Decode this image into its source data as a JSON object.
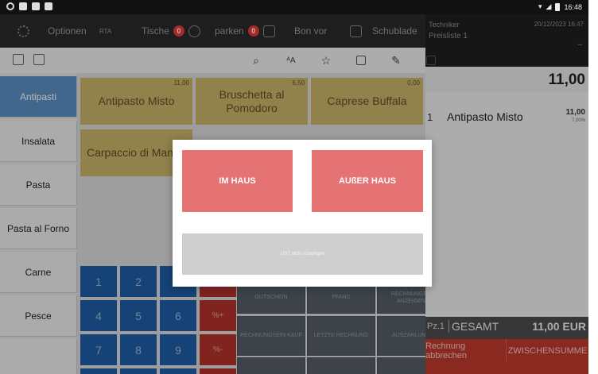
{
  "status_bar": {
    "time": "16:48"
  },
  "toolbar": {
    "options_label": "Optionen",
    "rta_label": "RTA",
    "tables_label": "Tische",
    "tables_badge": "0",
    "park_label": "parken",
    "park_badge": "0",
    "bon_label": "Bon vor",
    "drawer_label": "Schublade"
  },
  "header": {
    "user": "Techniker",
    "datetime": "20/12/2023 16:47",
    "pricelist": "Preisliste 1",
    "menu_glyph": "–"
  },
  "receipt_total": "11,00",
  "categories": [
    {
      "label": "Antipasti"
    },
    {
      "label": "Insalata"
    },
    {
      "label": "Pasta"
    },
    {
      "label": "Pasta al Forno"
    },
    {
      "label": "Carne"
    },
    {
      "label": "Pesce"
    }
  ],
  "products": [
    {
      "name": "Antipasto Misto",
      "price": "11,00"
    },
    {
      "name": "Bruschetta al Pomodoro",
      "price": "6,50"
    },
    {
      "name": "Caprese Buffala",
      "price": "0,00"
    },
    {
      "name": "Carpaccio di Man",
      "price": ""
    }
  ],
  "keypad": {
    "digits": [
      "1",
      "2",
      "4",
      "5",
      "6",
      "7",
      "8",
      "9"
    ],
    "ops": [
      "%+",
      "%-"
    ]
  },
  "function_buttons": {
    "voucher": "GUTSCHEIN",
    "deposit": "PFAND",
    "invoice_print": "RECHNUNGEN ANZEIGEN",
    "buy_invoice": "RECHNUNGSEIN-KAUF",
    "last_invoice": "LETZTE RECHNUNG",
    "payout": "AUSZAHLUNG"
  },
  "receipt_lines": [
    {
      "qty": "1",
      "name": "Antipasto Misto",
      "price": "11,00",
      "tax": "7,00%"
    }
  ],
  "summary": {
    "pieces": "Pz.1",
    "label": "GESAMT",
    "value": "11,00 EUR"
  },
  "actions": {
    "cancel": "Rechnung abbrechen",
    "subtotal": "ZWISCHENSUMME"
  },
  "dialog": {
    "dine_in": "IM HAUS",
    "take_away": "AUßER HAUS",
    "no_vat": "UST nicht erzwingen"
  }
}
